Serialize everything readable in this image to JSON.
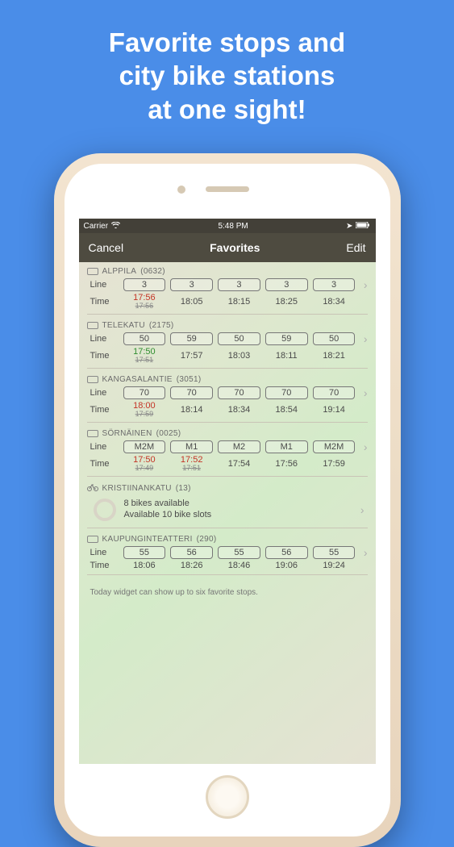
{
  "headline": {
    "line1": "Favorite stops and",
    "line2": "city bike stations",
    "line3": "at one sight!"
  },
  "statusbar": {
    "carrier": "Carrier",
    "time": "5:48 PM",
    "nav_icon": "➤"
  },
  "navbar": {
    "left": "Cancel",
    "title": "Favorites",
    "right": "Edit"
  },
  "labels": {
    "line": "Line",
    "time": "Time"
  },
  "stops": [
    {
      "name_part1": "ALPPILA",
      "name_part2": "(0632)",
      "mode": "tram",
      "lines": [
        "3",
        "3",
        "3",
        "3",
        "3"
      ],
      "times": [
        {
          "t": "17:56",
          "color": "red",
          "orig": "17:56"
        },
        {
          "t": "18:05"
        },
        {
          "t": "18:15"
        },
        {
          "t": "18:25"
        },
        {
          "t": "18:34"
        }
      ]
    },
    {
      "name_part1": "TELEKATU",
      "name_part2": "(2175)",
      "mode": "bus",
      "lines": [
        "50",
        "59",
        "50",
        "59",
        "50"
      ],
      "times": [
        {
          "t": "17:50",
          "color": "green",
          "orig": "17:51"
        },
        {
          "t": "17:57"
        },
        {
          "t": "18:03"
        },
        {
          "t": "18:11"
        },
        {
          "t": "18:21"
        }
      ]
    },
    {
      "name_part1": "KANGASALANTIE",
      "name_part2": "(3051)",
      "mode": "bus",
      "lines": [
        "70",
        "70",
        "70",
        "70",
        "70"
      ],
      "times": [
        {
          "t": "18:00",
          "color": "red",
          "orig": "17:59"
        },
        {
          "t": "18:14"
        },
        {
          "t": "18:34"
        },
        {
          "t": "18:54"
        },
        {
          "t": "19:14"
        }
      ]
    },
    {
      "name_part1": "SÖRNÄINEN",
      "name_part2": "(0025)",
      "mode": "metro",
      "lines": [
        "M2M",
        "M1",
        "M2",
        "M1",
        "M2M"
      ],
      "times": [
        {
          "t": "17:50",
          "color": "red",
          "orig": "17:49"
        },
        {
          "t": "17:52",
          "color": "red",
          "orig": "17:51"
        },
        {
          "t": "17:54"
        },
        {
          "t": "17:56"
        },
        {
          "t": "17:59"
        }
      ]
    }
  ],
  "bike_station": {
    "name_part1": "KRISTIINANKATU",
    "name_part2": "(13)",
    "available_text": "8 bikes available",
    "slots_text": "Available 10 bike slots"
  },
  "stops2": [
    {
      "name_part1": "KAUPUNGINTEATTERI",
      "name_part2": "(290)",
      "mode": "bus",
      "lines": [
        "55",
        "56",
        "55",
        "56",
        "55"
      ],
      "times": [
        {
          "t": "18:06"
        },
        {
          "t": "18:26"
        },
        {
          "t": "18:46"
        },
        {
          "t": "19:06"
        },
        {
          "t": "19:24"
        }
      ]
    }
  ],
  "footer": "Today widget can show up to six favorite stops."
}
